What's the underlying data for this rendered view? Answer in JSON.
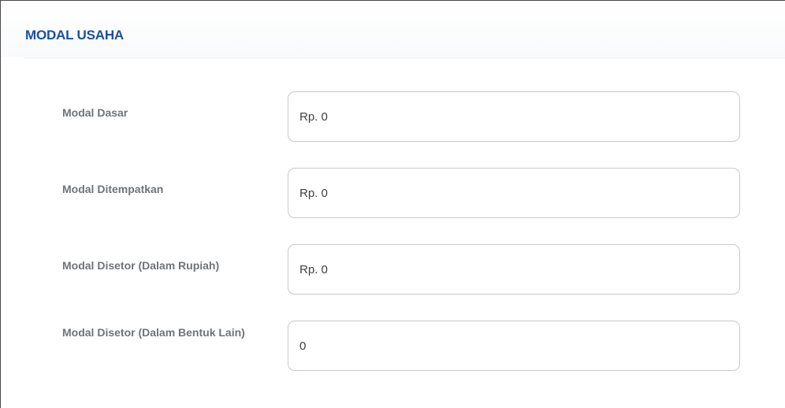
{
  "section": {
    "title": "MODAL USAHA"
  },
  "fields": [
    {
      "label": "Modal Dasar",
      "value": "Rp. 0"
    },
    {
      "label": "Modal Ditempatkan",
      "value": "Rp. 0"
    },
    {
      "label": "Modal Disetor (Dalam Rupiah)",
      "value": "Rp. 0"
    },
    {
      "label": "Modal Disetor (Dalam Bentuk Lain)",
      "value": "0"
    }
  ],
  "colors": {
    "title": "#1b4f9c",
    "label": "#6f7378",
    "input_border": "#c6cacf",
    "frame_border": "#4a4a4a"
  }
}
